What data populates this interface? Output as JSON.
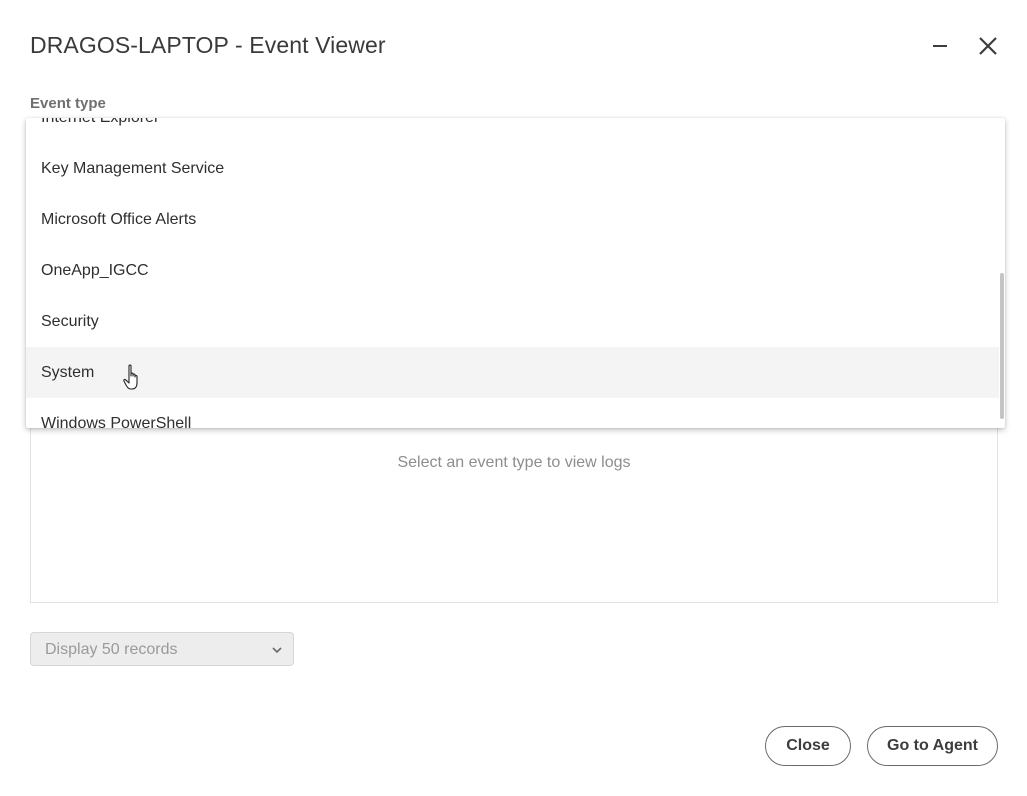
{
  "window": {
    "title": "DRAGOS-LAPTOP - Event Viewer",
    "minimize_icon": "minimize-icon",
    "close_icon": "close-icon"
  },
  "filter": {
    "label": "Event type",
    "dropdown_items": [
      "Internet Explorer",
      "Key Management Service",
      "Microsoft Office Alerts",
      "OneApp_IGCC",
      "Security",
      "System",
      "Windows PowerShell"
    ],
    "hovered_item": "System"
  },
  "log_panel": {
    "empty_message": "Select an event type to view logs"
  },
  "records": {
    "selected": "Display 50 records",
    "icon": "chevron-down-icon"
  },
  "footer": {
    "close_label": "Close",
    "agent_label": "Go to Agent"
  },
  "colors": {
    "title": "#3a3a3a",
    "hover_row": "#f4f4f4",
    "button_border": "#6a6a6a"
  }
}
